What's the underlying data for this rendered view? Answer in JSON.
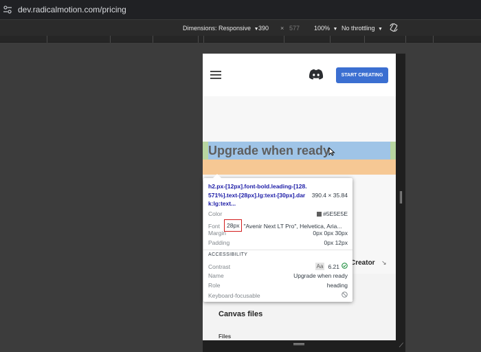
{
  "browser": {
    "url": "dev.radicalmotion.com/pricing"
  },
  "device_toolbar": {
    "dimensions_label": "Dimensions: Responsive",
    "width": "390",
    "times": "×",
    "height": "577",
    "zoom": "100%",
    "throttling": "No throttling"
  },
  "page": {
    "cta_label": "START CREATING",
    "heading": "Upgrade when ready",
    "creator_label": "Creator",
    "canvas_files_label": "Canvas files",
    "files_label": "Files"
  },
  "inspector": {
    "selector": "h2.px-[12px].font-bold.leading-[128.571%].text-[28px].lg:text-[30px].dark:lg:text...",
    "size": "390.4 × 35.84",
    "color_label": "Color",
    "color_value": "#5E5E5E",
    "font_label": "Font",
    "font_size": "28px",
    "font_family": "\"Avenir Next LT Pro\", Helvetica, Aria...",
    "margin_label": "Margin",
    "margin_value": "0px 0px 30px",
    "padding_label": "Padding",
    "padding_value": "0px 12px",
    "accessibility_title": "ACCESSIBILITY",
    "contrast_label": "Contrast",
    "contrast_aa": "Aa",
    "contrast_value": "6.21",
    "name_label": "Name",
    "name_value": "Upgrade when ready",
    "role_label": "Role",
    "role_value": "heading",
    "keyboard_label": "Keyboard-focusable"
  },
  "colors": {
    "heading_text": "#5E5E5E",
    "cta_bg": "#3B6FD1",
    "content_highlight": "#9fc4e7",
    "padding_highlight": "#b8d6a0",
    "margin_highlight": "#f6c894"
  }
}
